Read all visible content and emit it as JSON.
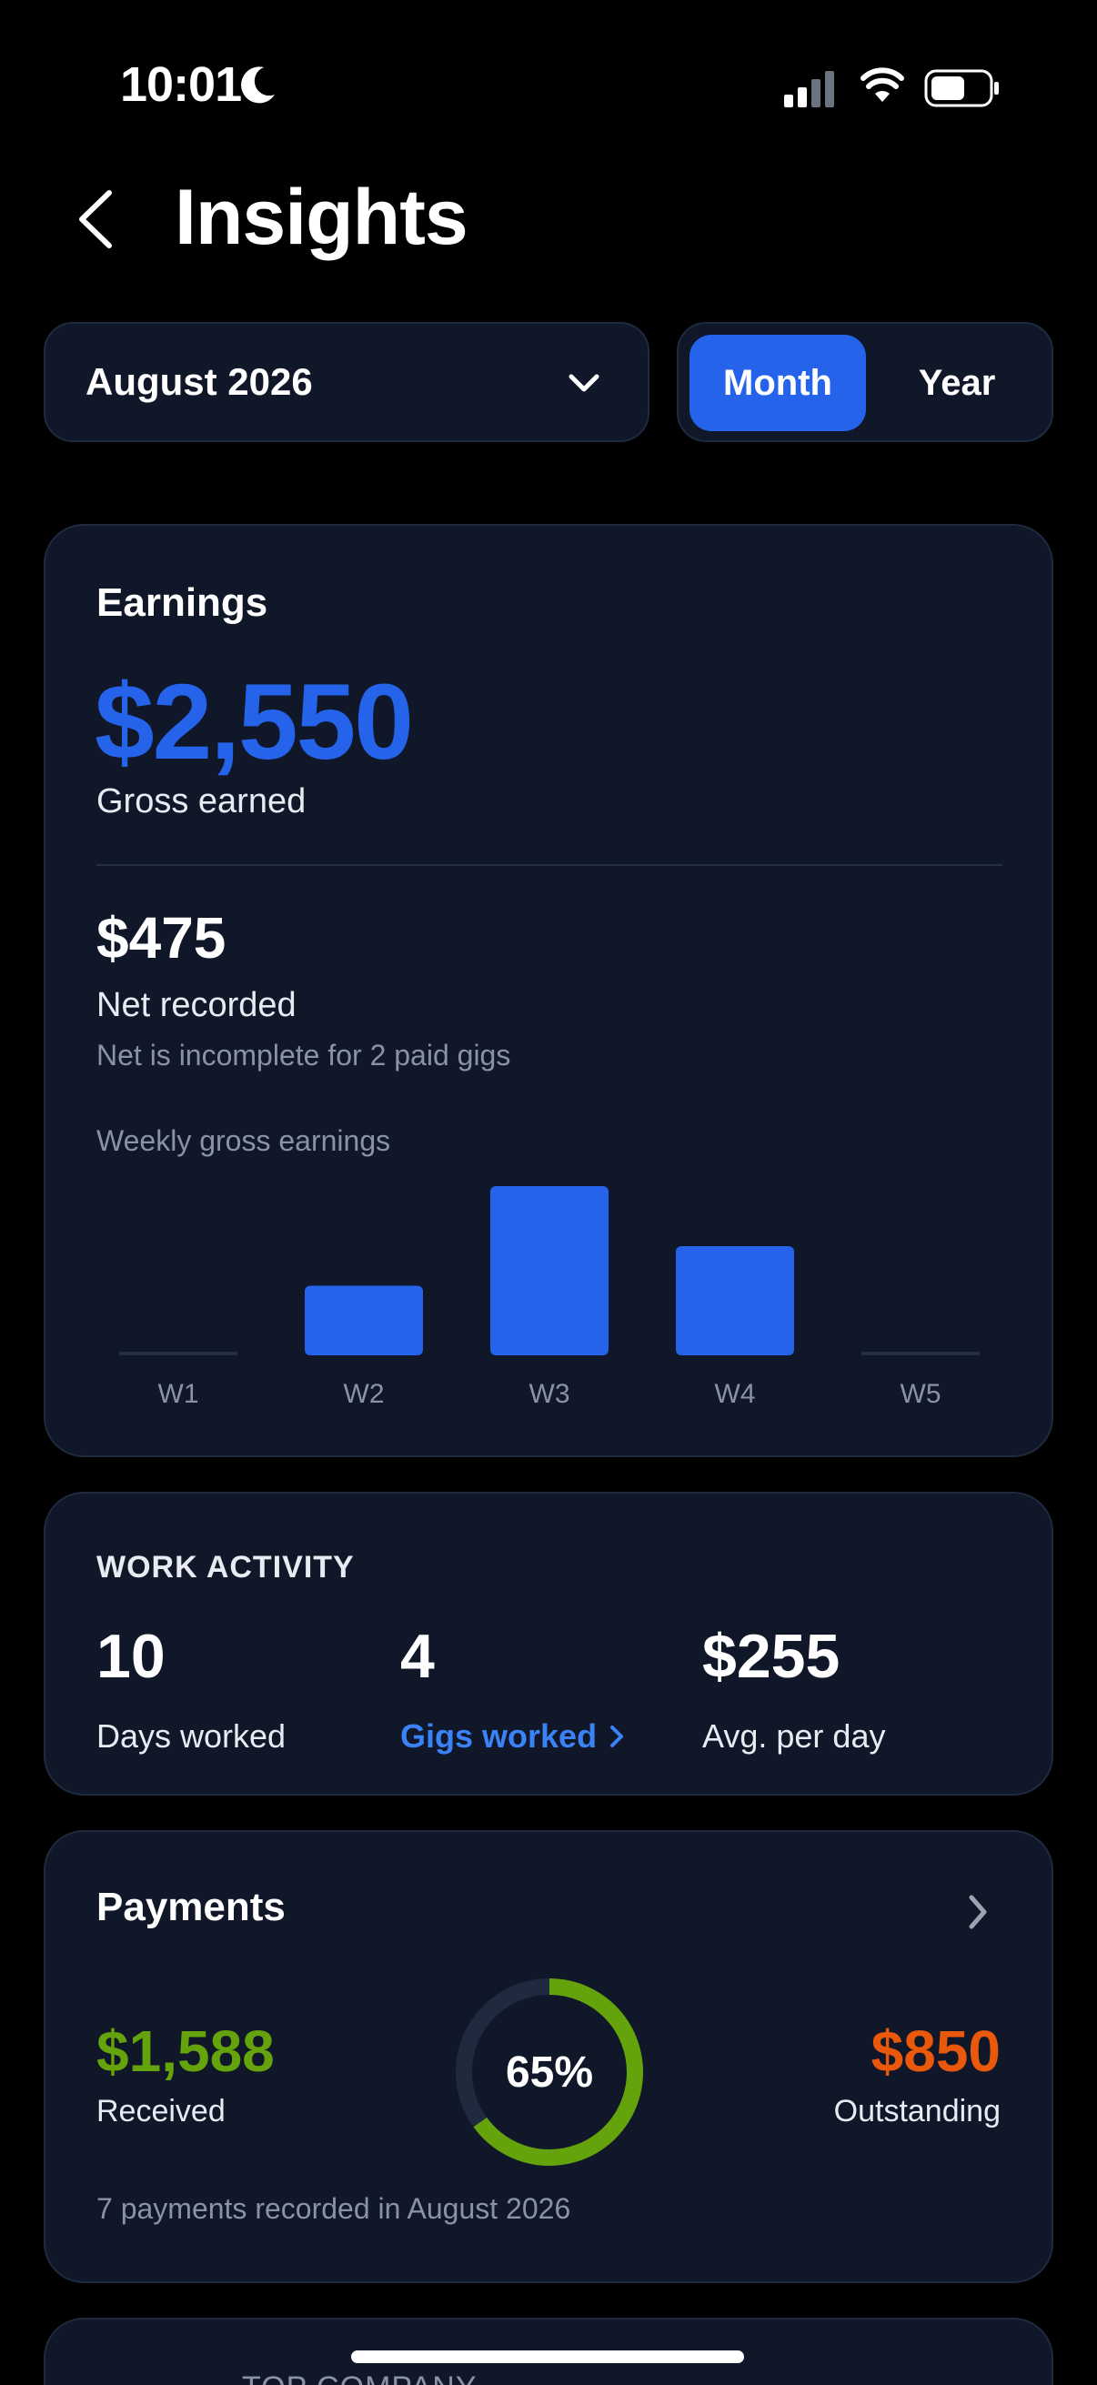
{
  "status_bar": {
    "time": "10:01"
  },
  "header": {
    "title": "Insights"
  },
  "period": {
    "selected": "August 2026",
    "toggle": {
      "month": "Month",
      "year": "Year",
      "active": "month"
    }
  },
  "earnings": {
    "title": "Earnings",
    "gross_amount": "$2,550",
    "gross_label": "Gross earned",
    "net_amount": "$475",
    "net_label": "Net recorded",
    "net_note": "Net is incomplete for 2 paid gigs",
    "chart_title": "Weekly gross earnings"
  },
  "chart_data": {
    "type": "bar",
    "title": "Weekly gross earnings",
    "categories": [
      "W1",
      "W2",
      "W3",
      "W4",
      "W5"
    ],
    "values": [
      0,
      510,
      1240,
      800,
      0
    ],
    "ylim": [
      0,
      1240
    ],
    "grid": false,
    "bar_color": "#2563eb"
  },
  "work_activity": {
    "title": "WORK ACTIVITY",
    "days_value": "10",
    "days_label": "Days worked",
    "gigs_value": "4",
    "gigs_label": "Gigs worked",
    "avg_value": "$255",
    "avg_label": "Avg. per day"
  },
  "payments": {
    "title": "Payments",
    "received_amount": "$1,588",
    "received_label": "Received",
    "percent_label": "65%",
    "percent": 65,
    "outstanding_amount": "$850",
    "outstanding_label": "Outstanding",
    "note": "7 payments recorded in August 2026"
  },
  "next_card": {
    "label": "TOP COMPANY"
  },
  "colors": {
    "accent": "#2563eb",
    "received": "#65a30d",
    "outstanding": "#ea580c",
    "card_bg": "#0f1728"
  }
}
